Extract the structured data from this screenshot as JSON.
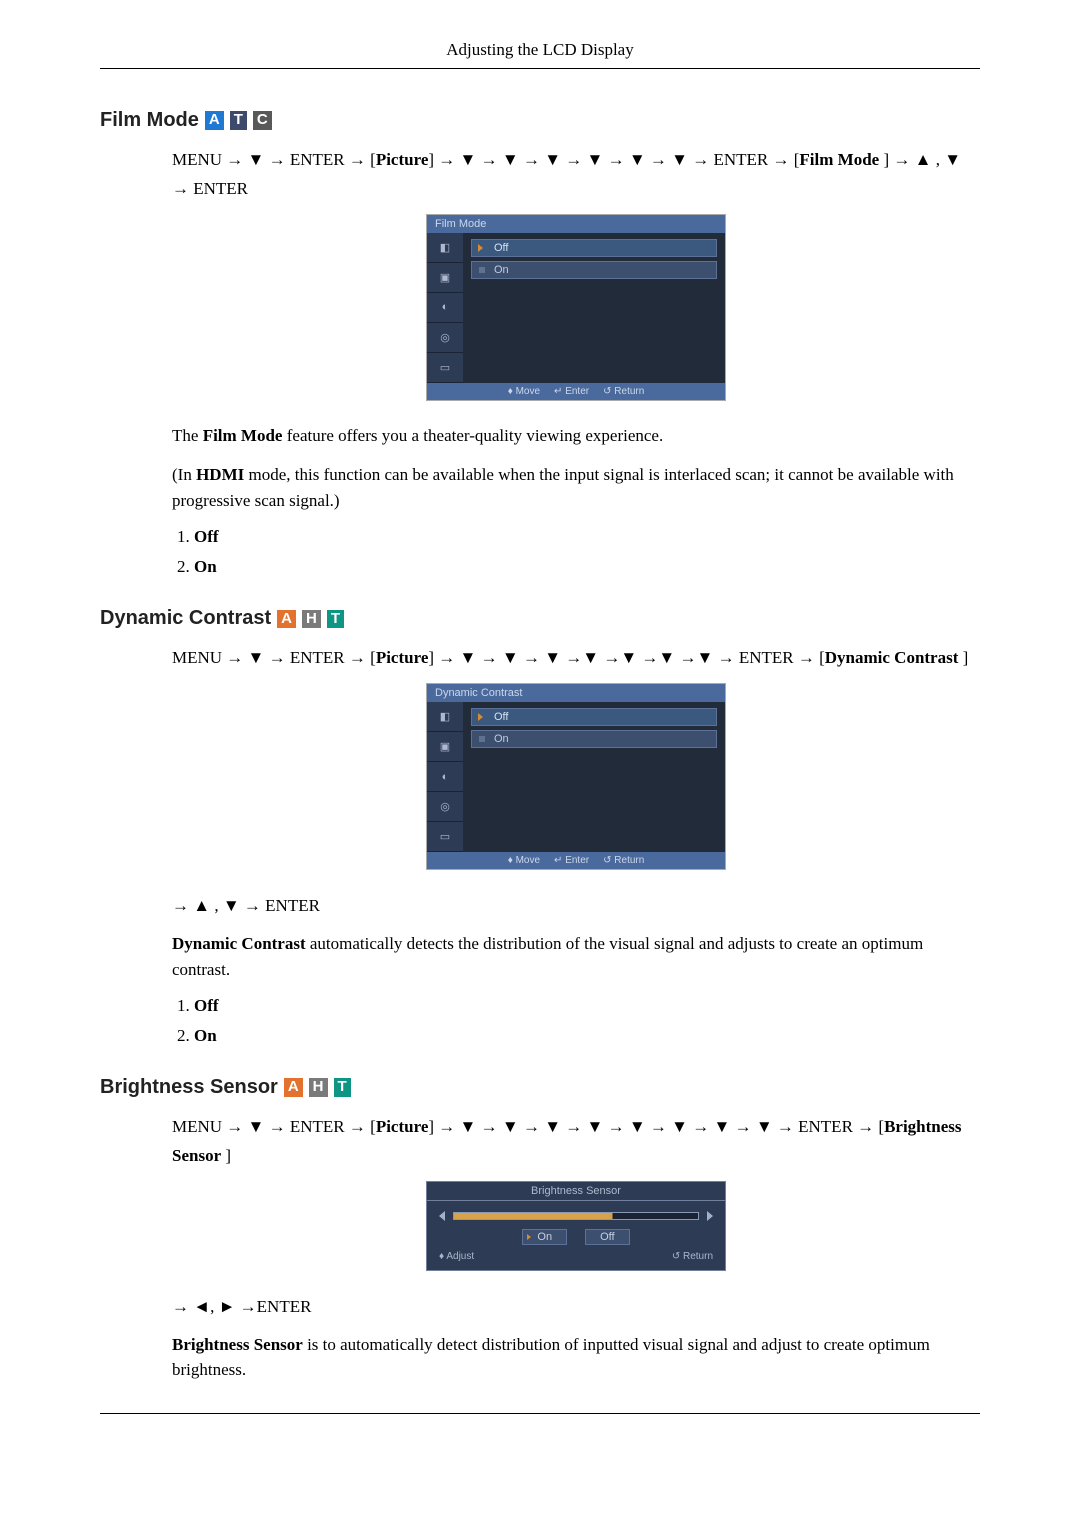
{
  "header": {
    "title": "Adjusting the LCD Display"
  },
  "badges": {
    "A": "A",
    "T": "T",
    "C": "C",
    "H": "H"
  },
  "film": {
    "title": "Film Mode",
    "nav_pre": "MENU → ▼ → ENTER → [",
    "nav_b1": "Picture",
    "nav_mid": "] → ▼ → ▼ → ▼ → ▼ → ▼ → ▼ → ENTER → [",
    "nav_b2": "Film Mode",
    "nav_post": " ] → ▲ , ▼ → ENTER",
    "osd_title": "Film Mode",
    "osd_opt1": "Off",
    "osd_opt2": "On",
    "osd_footer_move": "Move",
    "osd_footer_enter": "Enter",
    "osd_footer_return": "Return",
    "desc_pre": "The ",
    "desc_b": "Film Mode",
    "desc_post": " feature offers you a theater-quality viewing experience.",
    "hdmi_pre": "(In ",
    "hdmi_b": "HDMI",
    "hdmi_post": " mode, this function can be available when the input signal is interlaced scan; it cannot be available with progressive scan signal.)",
    "opt1": "Off",
    "opt2": "On"
  },
  "dyn": {
    "title": "Dynamic Contrast",
    "nav_pre": "MENU → ▼ → ENTER → [",
    "nav_b1": "Picture",
    "nav_mid": "] → ▼ → ▼ → ▼ →▼ →▼ →▼ →▼ → ENTER → [",
    "nav_b2": "Dynamic Contrast",
    "nav_post": " ]",
    "osd_title": "Dynamic Contrast",
    "osd_opt1": "Off",
    "osd_opt2": "On",
    "osd_footer_move": "Move",
    "osd_footer_enter": "Enter",
    "osd_footer_return": "Return",
    "nav2": "→ ▲ , ▼ → ENTER",
    "desc_b": "Dynamic Contrast",
    "desc_post": " automatically detects the distribution of the visual signal and adjusts to create an optimum contrast.",
    "opt1": "Off",
    "opt2": "On"
  },
  "bri": {
    "title": "Brightness Sensor",
    "nav_pre": "MENU → ▼ → ENTER → [",
    "nav_b1": "Picture",
    "nav_mid": "] → ▼ → ▼ → ▼ → ▼ → ▼ → ▼ → ▼ → ▼ → ENTER → [",
    "nav_b2": "Brightness Sensor",
    "nav_post": " ]",
    "osd_title": "Brightness Sensor",
    "osd_on": "On",
    "osd_off": "Off",
    "osd_adjust": "Adjust",
    "osd_return": "Return",
    "nav2": "→ ◄, ► →ENTER",
    "desc_b": "Brightness Sensor",
    "desc_post": " is to automatically detect distribution of inputted visual signal and adjust to create optimum brightness."
  }
}
